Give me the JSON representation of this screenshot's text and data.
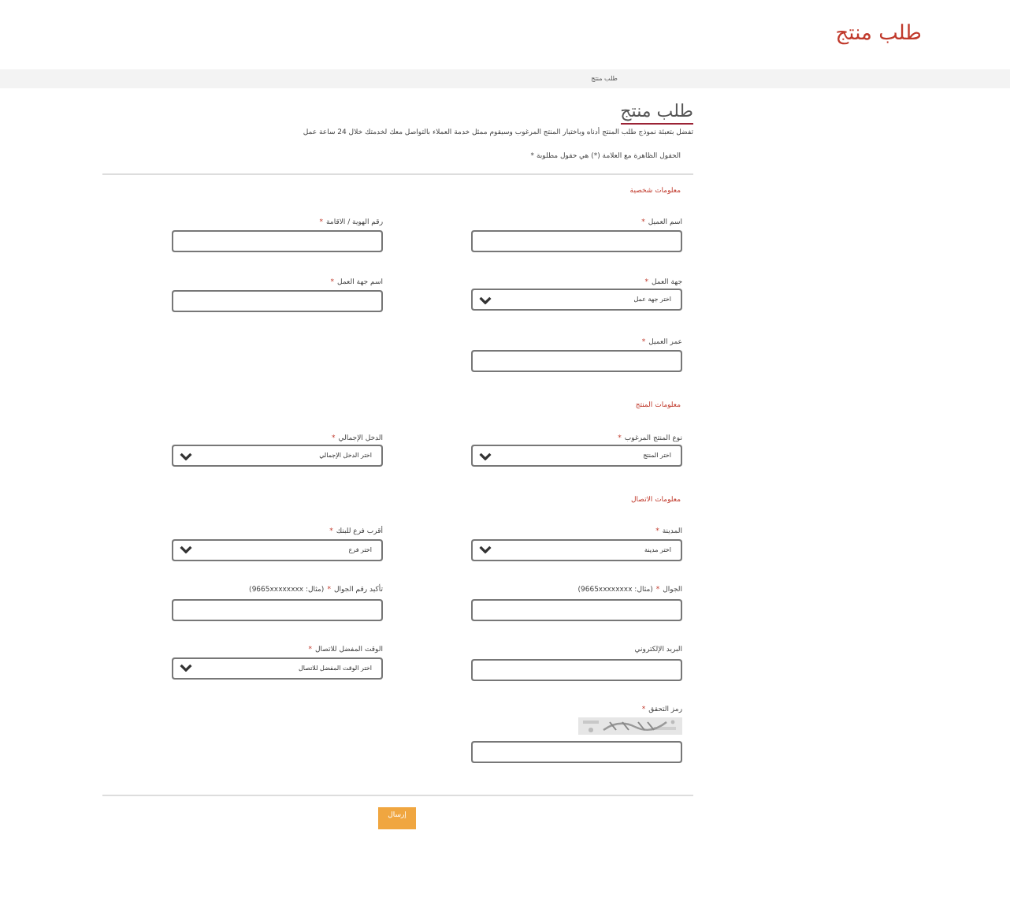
{
  "header": {
    "title": "طلب منتج"
  },
  "breadcrumb": "طلب منتج",
  "page_title": "طلب منتج",
  "description": "تفضل بتعبئة نموذج طلب المنتج أدناه وباختيار المنتج المرغوب وسيقوم ممثل خدمة العملاء بالتواصل معك لخدمتك خلال 24 ساعة عمل",
  "required_note": "الحقول الظاهرة مع العلامة (*) هي حقول مطلوبة *",
  "sections": [
    {
      "title": "معلومات شخصية",
      "rows": [
        [
          {
            "kind": "text",
            "label": "اسم العميل",
            "mark": "*"
          },
          {
            "kind": "text",
            "label": "رقم الهوية / الاقامة",
            "mark": "*"
          }
        ],
        [
          {
            "kind": "select",
            "label": "جهة العمل",
            "mark": "*",
            "value": "اختر جهة عمل"
          },
          {
            "kind": "text",
            "label": "اسم جهة العمل",
            "mark": "*"
          }
        ],
        [
          {
            "kind": "text",
            "label": "عمر العميل",
            "mark": "*"
          }
        ]
      ]
    },
    {
      "title": "معلومات المنتج",
      "rows": [
        [
          {
            "kind": "select",
            "label": "نوع المنتج المرغوب",
            "mark": "*",
            "value": "اختر المنتج"
          },
          {
            "kind": "select",
            "label": "الدخل الإجمالي",
            "mark": "*",
            "value": "اختر الدخل الإجمالي"
          }
        ]
      ]
    },
    {
      "title": "معلومات الاتصال",
      "rows": [
        [
          {
            "kind": "select",
            "label": "المدينة",
            "mark": "*",
            "value": "اختر مدينة"
          },
          {
            "kind": "select",
            "label": "أقرب فرع للبنك",
            "mark": "*",
            "value": "اختر فرع"
          }
        ],
        [
          {
            "kind": "text",
            "label": "الجوال",
            "mark": "*",
            "hint": "(مثال: 9665xxxxxxxx)"
          },
          {
            "kind": "text",
            "label": "تأكيد رقم الجوال",
            "mark": "*",
            "hint": "(مثال: 9665xxxxxxxx)"
          }
        ],
        [
          {
            "kind": "text",
            "label": "البريد الإلكتروني"
          },
          {
            "kind": "select",
            "label": "الوقت المفضل للاتصال",
            "mark": "*",
            "value": "اختر الوقت المفضل للاتصال"
          }
        ],
        [
          {
            "kind": "captcha",
            "label": "رمز التحقق",
            "mark": "*"
          }
        ]
      ]
    }
  ],
  "submit": "إرسال"
}
